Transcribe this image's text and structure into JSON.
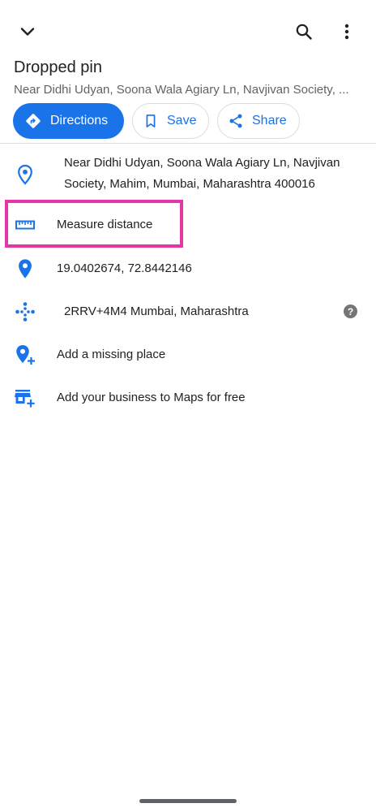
{
  "header": {
    "title": "Dropped pin",
    "subtitle": "Near Didhi Udyan, Soona Wala Agiary Ln, Navjivan Society, ..."
  },
  "actions": {
    "directions_label": "Directions",
    "save_label": "Save",
    "share_label": "Share"
  },
  "details": {
    "address_line1": "Near Didhi Udyan, Soona Wala Agiary Ln, Navjivan",
    "address_line2": "Society, Mahim, Mumbai, Maharashtra 400016",
    "measure_label": "Measure distance",
    "coordinates": "19.0402674, 72.8442146",
    "plus_code": "2RRV+4M4 Mumbai, Maharashtra",
    "help_glyph": "?",
    "add_missing_place": "Add a missing place",
    "add_business": "Add your business to Maps for free"
  },
  "colors": {
    "accent": "#1a73e8",
    "highlight": "#e535ab",
    "text": "#202124",
    "secondary_text": "#5f6368"
  }
}
